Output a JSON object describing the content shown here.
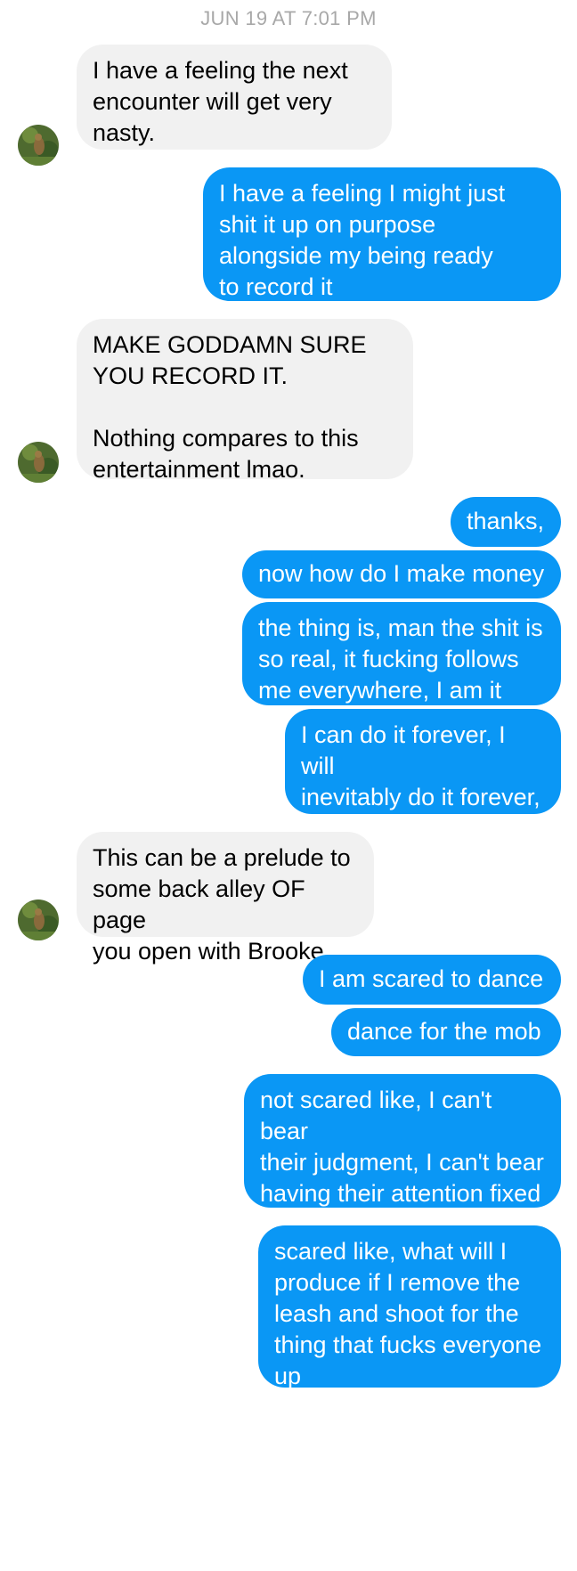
{
  "thread": {
    "timestamp": "JUN 19 AT 7:01 PM",
    "messages": [
      {
        "id": "m1",
        "from": "them",
        "text": "I have a feeling the next\nencounter will get very\nnasty."
      },
      {
        "id": "m2",
        "from": "me",
        "text": "I have a feeling I might just\nshit it up on purpose\nalongside my being ready\nto record it"
      },
      {
        "id": "m3",
        "from": "them",
        "text": "MAKE GODDAMN SURE\nYOU RECORD IT.\n\nNothing compares to this\nentertainment lmao."
      },
      {
        "id": "m4",
        "from": "me",
        "text": "thanks,"
      },
      {
        "id": "m5",
        "from": "me",
        "text": "now how do I make money"
      },
      {
        "id": "m6",
        "from": "me",
        "text": "the thing is, man the shit is\nso real, it fucking follows\nme everywhere, I am it"
      },
      {
        "id": "m7",
        "from": "me",
        "text": "I can do it forever, I will\ninevitably do it forever,\nwhere is the money"
      },
      {
        "id": "m8",
        "from": "them",
        "text": "This can be a prelude to\nsome back alley OF page\nyou open with Brooke."
      },
      {
        "id": "m9",
        "from": "me",
        "text": "I am scared to dance"
      },
      {
        "id": "m10",
        "from": "me",
        "text": "dance for the mob"
      },
      {
        "id": "m11",
        "from": "me",
        "text": "not scared like, I can't bear\ntheir judgment, I can't bear\nhaving their attention fixed\non me, no, not that"
      },
      {
        "id": "m12",
        "from": "me",
        "text": "scared like, what will I\nproduce if I remove the\nleash and shoot for the\nthing that fucks everyone\nup"
      }
    ]
  },
  "colors": {
    "outgoing_bubble": "#0a97f5",
    "incoming_bubble": "#f1f1f1",
    "timestamp_text": "#a8a8a8"
  },
  "icons": {
    "avatar": "contact-avatar-photo"
  }
}
